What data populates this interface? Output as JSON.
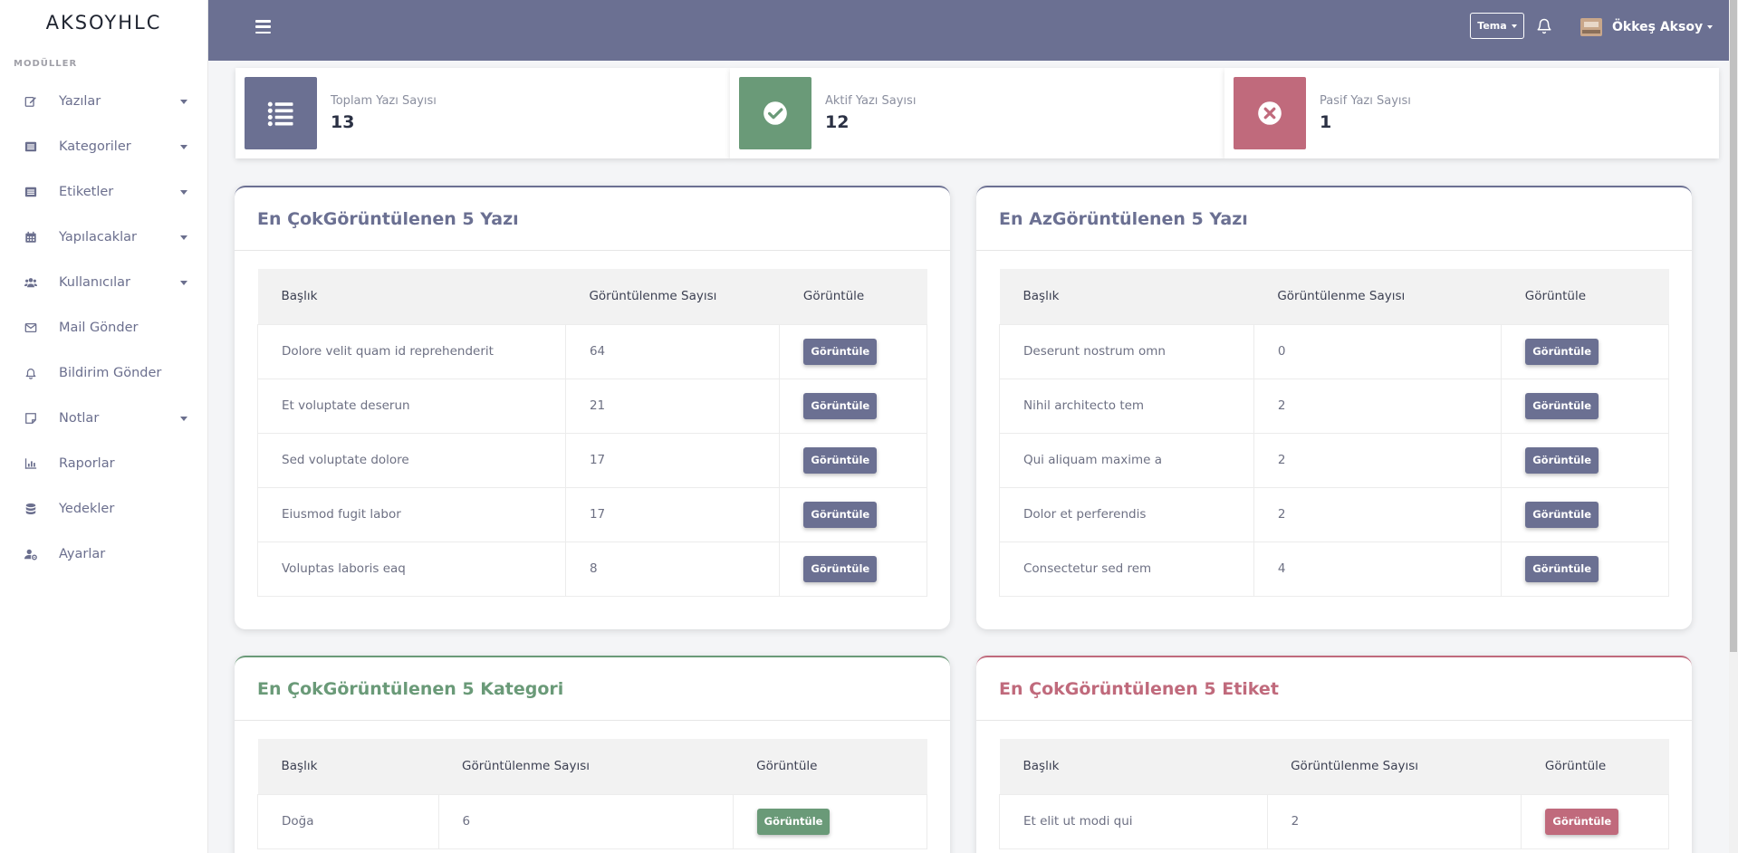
{
  "brand": "AKSOYHLC",
  "sidebar": {
    "section_label": "MODÜLLER",
    "items": [
      {
        "label": "Yazılar",
        "icon": "edit-icon",
        "has_caret": true
      },
      {
        "label": "Kategoriler",
        "icon": "list-box-icon",
        "has_caret": true
      },
      {
        "label": "Etiketler",
        "icon": "list-box-icon",
        "has_caret": true
      },
      {
        "label": "Yapılacaklar",
        "icon": "calendar-icon",
        "has_caret": true
      },
      {
        "label": "Kullanıcılar",
        "icon": "users-icon",
        "has_caret": true
      },
      {
        "label": "Mail Gönder",
        "icon": "envelope-icon",
        "has_caret": false
      },
      {
        "label": "Bildirim Gönder",
        "icon": "bell-icon",
        "has_caret": false
      },
      {
        "label": "Notlar",
        "icon": "note-icon",
        "has_caret": true
      },
      {
        "label": "Raporlar",
        "icon": "bar-chart-icon",
        "has_caret": false
      },
      {
        "label": "Yedekler",
        "icon": "database-icon",
        "has_caret": false
      },
      {
        "label": "Ayarlar",
        "icon": "user-gear-icon",
        "has_caret": false
      }
    ]
  },
  "topbar": {
    "theme_label": "Tema",
    "user_name": "Ökkeş Aksoy"
  },
  "stats": [
    {
      "label": "Toplam Yazı Sayısı",
      "value": "13",
      "icon": "list-icon",
      "color": "#6b7092"
    },
    {
      "label": "Aktif Yazı Sayısı",
      "value": "12",
      "icon": "check-circle-icon",
      "color": "#6a9a78"
    },
    {
      "label": "Pasif Yazı Sayısı",
      "value": "1",
      "icon": "x-circle-icon",
      "color": "#c06a7c"
    }
  ],
  "panels": {
    "most_viewed_posts": {
      "title_bold": "En Çok",
      "title_rest": " Görüntülenen 5 Yazı",
      "color": "#6b7092",
      "headers": [
        "Başlık",
        "Görüntülenme Sayısı",
        "Görüntüle"
      ],
      "rows": [
        {
          "title": "Dolore velit quam id reprehenderit",
          "views": "64",
          "button": "Görüntüle"
        },
        {
          "title": "Et voluptate deserun",
          "views": "21",
          "button": "Görüntüle"
        },
        {
          "title": "Sed voluptate dolore",
          "views": "17",
          "button": "Görüntüle"
        },
        {
          "title": "Eiusmod fugit labor",
          "views": "17",
          "button": "Görüntüle"
        },
        {
          "title": "Voluptas laboris eaq",
          "views": "8",
          "button": "Görüntüle"
        }
      ]
    },
    "least_viewed_posts": {
      "title_bold": "En Az",
      "title_rest": " Görüntülenen 5 Yazı",
      "color": "#6b7092",
      "headers": [
        "Başlık",
        "Görüntülenme Sayısı",
        "Görüntüle"
      ],
      "rows": [
        {
          "title": "Deserunt nostrum omn",
          "views": "0",
          "button": "Görüntüle"
        },
        {
          "title": "Nihil architecto tem",
          "views": "2",
          "button": "Görüntüle"
        },
        {
          "title": "Qui aliquam maxime a",
          "views": "2",
          "button": "Görüntüle"
        },
        {
          "title": "Dolor et perferendis",
          "views": "2",
          "button": "Görüntüle"
        },
        {
          "title": "Consectetur sed rem",
          "views": "4",
          "button": "Görüntüle"
        }
      ]
    },
    "most_viewed_categories": {
      "title_bold": "En Çok",
      "title_rest": " Görüntülenen 5 Kategori",
      "color": "#6a9a78",
      "headers": [
        "Başlık",
        "Görüntülenme Sayısı",
        "Görüntüle"
      ],
      "rows": [
        {
          "title": "Doğa",
          "views": "6",
          "button": "Görüntüle"
        }
      ]
    },
    "most_viewed_tags": {
      "title_bold": "En Çok",
      "title_rest": " Görüntülenen 5 Etiket",
      "color": "#c06a7c",
      "headers": [
        "Başlık",
        "Görüntülenme Sayısı",
        "Görüntüle"
      ],
      "rows": [
        {
          "title": "Et elit ut modi qui",
          "views": "2",
          "button": "Görüntüle"
        }
      ]
    }
  }
}
